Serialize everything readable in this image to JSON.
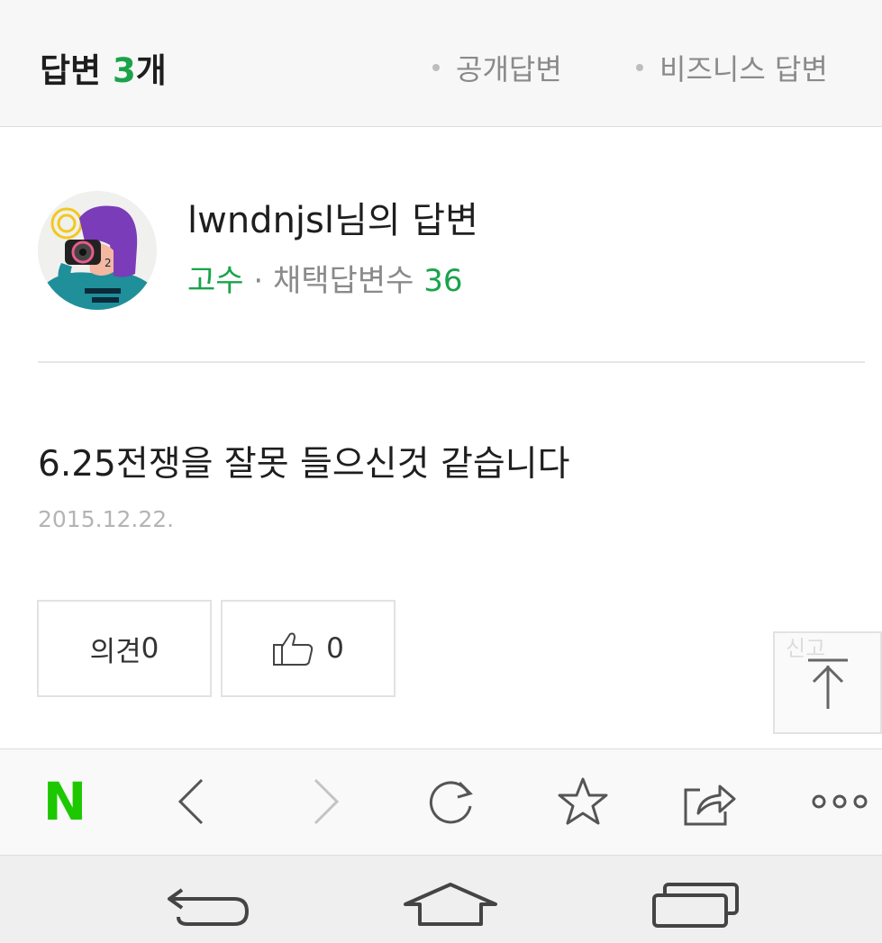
{
  "header": {
    "answers_label": "답변",
    "answers_count": "3",
    "answers_suffix": "개",
    "filters": [
      "공개답변",
      "비즈니스 답변"
    ]
  },
  "profile": {
    "author_name": "lwndnjsl님의 답변",
    "rank": "고수",
    "separator": "·",
    "adopted_label": "채택답변수",
    "adopted_count": "36"
  },
  "answer": {
    "text": "6.25전쟁을 잘못 들으신것 같습니다",
    "date": "2015.12.22."
  },
  "actions": {
    "comment_label": "의견",
    "comment_count": "0",
    "like_count": "0"
  },
  "floating": {
    "report_label": "신고"
  },
  "browser_toolbar": {
    "logo": "N",
    "icons": [
      "back-icon",
      "forward-icon",
      "reload-icon",
      "star-icon",
      "share-icon",
      "more-icon"
    ]
  },
  "system_nav": {
    "icons": [
      "back-icon",
      "home-icon",
      "recent-apps-icon"
    ]
  },
  "colors": {
    "accent_green": "#1aa34a",
    "naver_green": "#1ec800",
    "muted": "#8a8a8a"
  }
}
